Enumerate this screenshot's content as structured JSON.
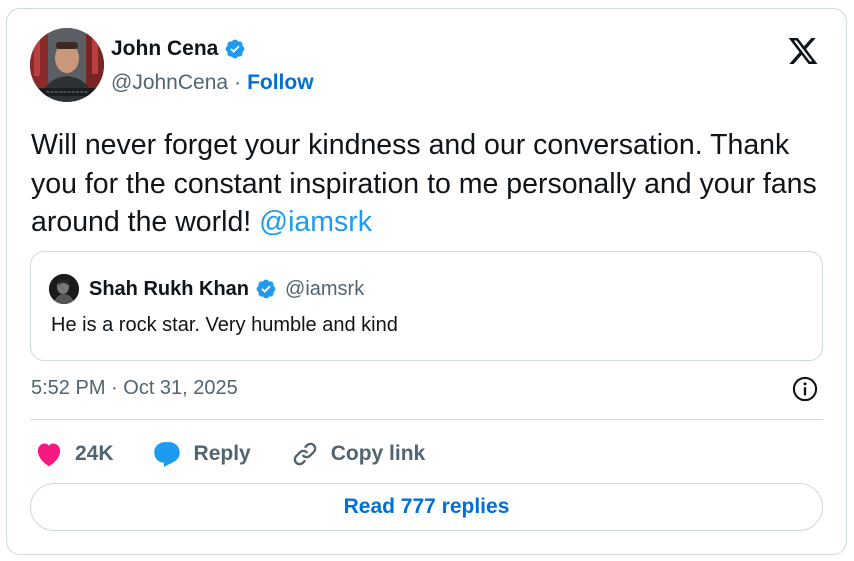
{
  "author": {
    "display_name": "John Cena",
    "handle": "@JohnCena",
    "separator": "·",
    "follow_label": "Follow",
    "avatar_icon": "avatar-photo",
    "verified_icon": "verified-badge-icon"
  },
  "tweet": {
    "text": "Will never forget your kindness and our conversation. Thank you for the constant inspiration to me personally and your fans around the world!",
    "mention": "@iamsrk"
  },
  "quote": {
    "display_name": "Shah Rukh Khan",
    "handle": "@iamsrk",
    "text": "He is a rock star. Very humble and kind"
  },
  "meta": {
    "timestamp": "5:52 PM · Oct 31, 2025"
  },
  "actions": {
    "likes_count": "24K",
    "reply_label": "Reply",
    "copy_link_label": "Copy link"
  },
  "read_replies_label": "Read 777 replies",
  "colors": {
    "link_blue": "#006fd6",
    "mention_blue": "#1d9bf0",
    "like_pink": "#f91880",
    "reply_blue": "#1d9bf0",
    "secondary_text": "#536471",
    "border": "#cfd9de"
  }
}
